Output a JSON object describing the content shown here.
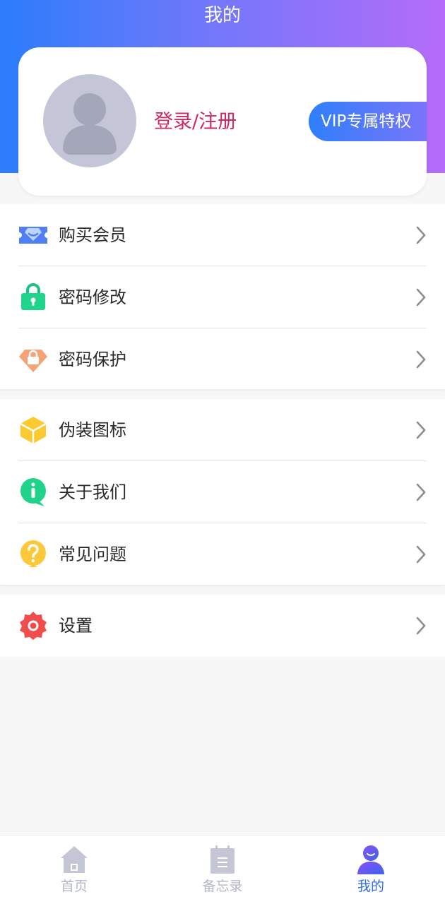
{
  "header": {
    "title": "我的"
  },
  "profile": {
    "login_label": "登录/注册",
    "vip_label": "VIP专属特权"
  },
  "menu": {
    "section1": [
      {
        "label": "购买会员",
        "icon": "vip-card-icon"
      },
      {
        "label": "密码修改",
        "icon": "green-lock-icon"
      },
      {
        "label": "密码保护",
        "icon": "orange-shield-lock-icon"
      }
    ],
    "section2": [
      {
        "label": "伪装图标",
        "icon": "yellow-cube-icon"
      },
      {
        "label": "关于我们",
        "icon": "green-info-icon"
      },
      {
        "label": "常见问题",
        "icon": "yellow-question-icon"
      }
    ],
    "section3": [
      {
        "label": "设置",
        "icon": "red-gear-icon"
      }
    ]
  },
  "tabs": [
    {
      "label": "首页",
      "icon": "home-icon",
      "active": false
    },
    {
      "label": "备忘录",
      "icon": "memo-icon",
      "active": false
    },
    {
      "label": "我的",
      "icon": "profile-icon",
      "active": true
    }
  ],
  "colors": {
    "header_gradient": [
      "#2b7dfb",
      "#b56cf9"
    ],
    "login_text": "#d1275e",
    "active_tab": "#2f6fe8",
    "inactive_tab": "#b3b6c6"
  }
}
